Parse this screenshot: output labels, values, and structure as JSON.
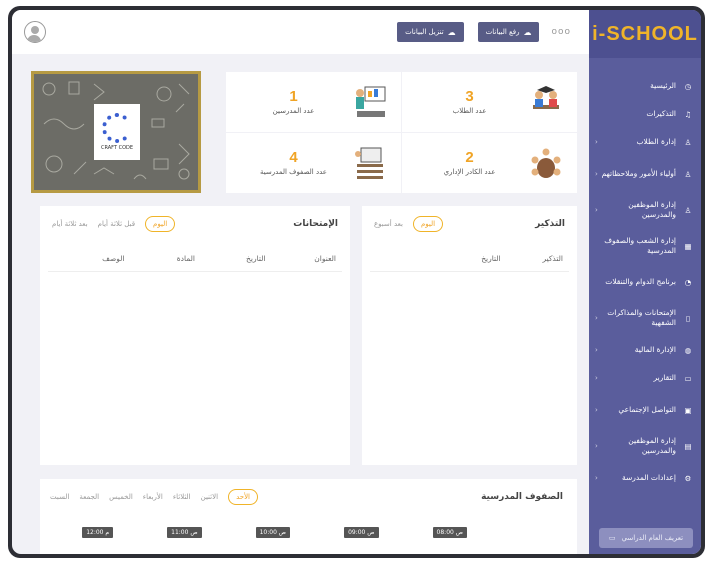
{
  "logo": "i-SCHOOL",
  "sidebar": {
    "items": [
      {
        "label": "الرئيسية",
        "icon": "dashboard-icon",
        "chevron": false
      },
      {
        "label": "التذكيرات",
        "icon": "bell-icon",
        "chevron": false
      },
      {
        "label": "إدارة الطلاب",
        "icon": "user-icon",
        "chevron": true
      },
      {
        "label": "أولياء الأمور وملاحظاتهم",
        "icon": "parents-icon",
        "chevron": true
      },
      {
        "label": "إدارة الموظفين والمدرسين",
        "icon": "staff-icon",
        "chevron": true
      },
      {
        "label": "إدارة الشعب والصفوف المدرسية",
        "icon": "grid-icon",
        "chevron": false
      },
      {
        "label": "برنامج الدوام والتنقلات",
        "icon": "clock-icon",
        "chevron": false
      },
      {
        "label": "الإمتحانات والمذاكرات الشفهية",
        "icon": "exam-icon",
        "chevron": true
      },
      {
        "label": "الإدارة المالية",
        "icon": "money-icon",
        "chevron": true
      },
      {
        "label": "التقارير",
        "icon": "report-icon",
        "chevron": true
      },
      {
        "label": "التواصل الإجتماعي",
        "icon": "chat-icon",
        "chevron": true
      },
      {
        "label": "إدارة الموظفين والمدرسين",
        "icon": "id-card-icon",
        "chevron": true
      },
      {
        "label": "إعدادات المدرسة",
        "icon": "settings-icon",
        "chevron": true
      }
    ],
    "cta": "تعريف العام الدراسي"
  },
  "topbar": {
    "dots": "ooo",
    "upload": "رفع البيانات",
    "download": "تنزيل البيانات"
  },
  "stats": [
    {
      "value": "3",
      "label": "عدد الطلاب"
    },
    {
      "value": "1",
      "label": "عدد المدرسين"
    },
    {
      "value": "2",
      "label": "عدد الكادر الإداري"
    },
    {
      "value": "4",
      "label": "عدد الصفوف المدرسية"
    }
  ],
  "banner": {
    "logo_text": "CRAFT CODE"
  },
  "reminders": {
    "title": "التذكير",
    "tabs": [
      "اليوم",
      "بعد أسبوع"
    ],
    "columns": [
      "التذكير",
      "التاريخ"
    ]
  },
  "exams": {
    "title": "الإمتحانات",
    "tabs": [
      "اليوم",
      "قبل ثلاثة أيام",
      "بعد ثلاثة أيام"
    ],
    "columns": [
      "العنوان",
      "التاريخ",
      "المادة",
      "الوصف"
    ]
  },
  "classes": {
    "title": "الصفوف المدرسية",
    "days": [
      "الأحد",
      "الاثنين",
      "الثلاثاء",
      "الأربعاء",
      "الخميس",
      "الجمعة",
      "السبت"
    ],
    "times": [
      "08:00 ص",
      "09:00 ص",
      "10:00 ص",
      "11:00 ص",
      "12:00 م"
    ]
  },
  "colors": {
    "sidebar": "#5a5d9c",
    "accent": "#f0a426",
    "button": "#585c86"
  }
}
